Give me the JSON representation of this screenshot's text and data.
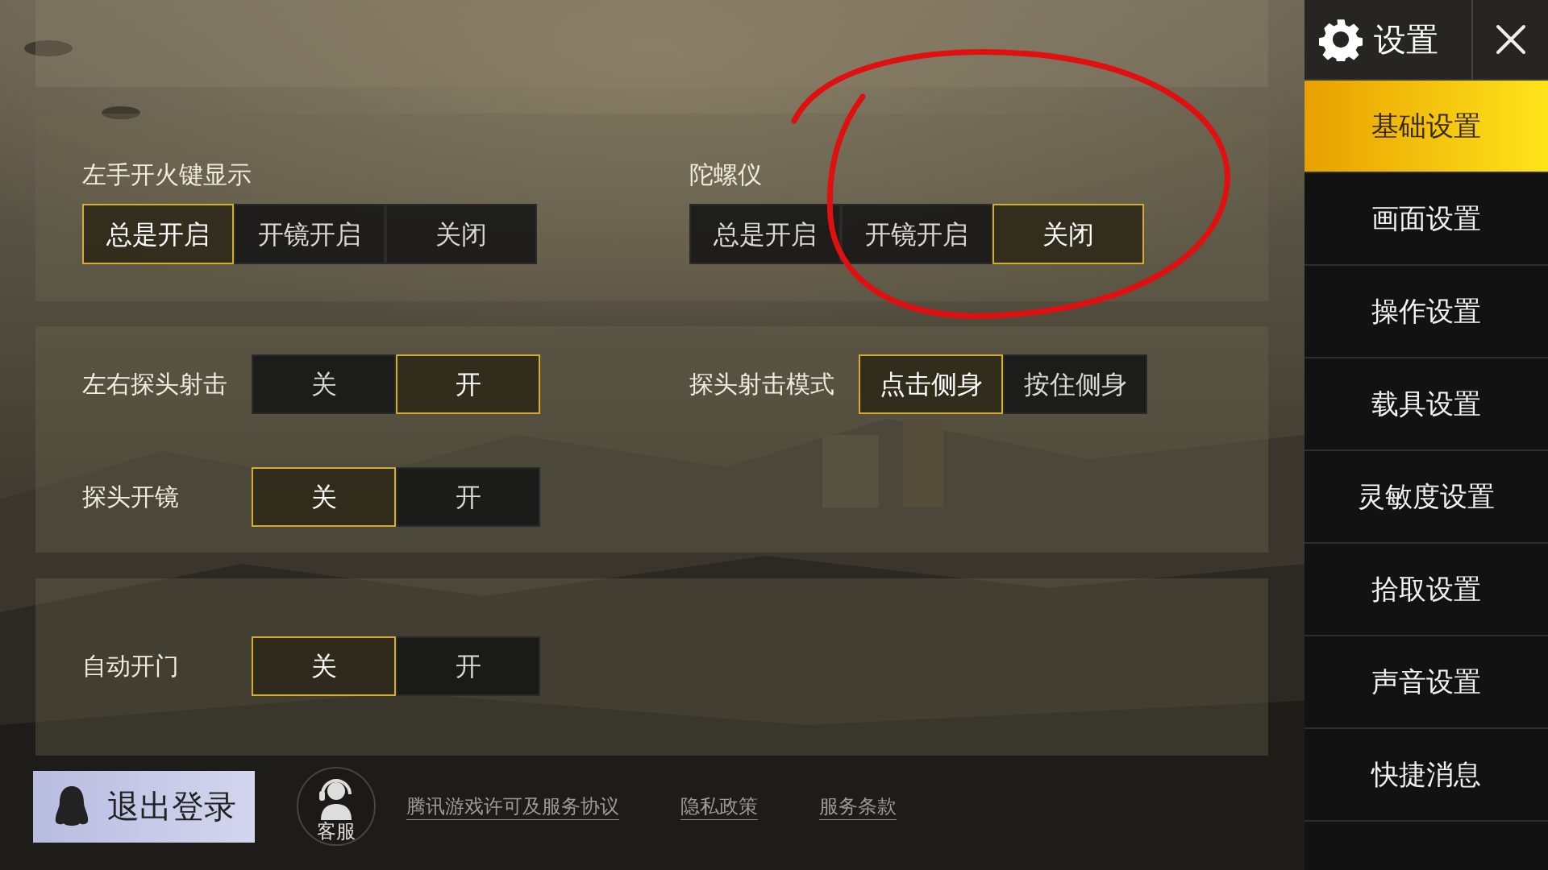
{
  "sidebar": {
    "title": "设置",
    "items": [
      {
        "label": "基础设置",
        "selected": true
      },
      {
        "label": "画面设置",
        "selected": false
      },
      {
        "label": "操作设置",
        "selected": false
      },
      {
        "label": "载具设置",
        "selected": false
      },
      {
        "label": "灵敏度设置",
        "selected": false
      },
      {
        "label": "拾取设置",
        "selected": false
      },
      {
        "label": "声音设置",
        "selected": false
      },
      {
        "label": "快捷消息",
        "selected": false
      }
    ]
  },
  "panels": [
    {
      "rows": [
        [
          {
            "kind": "stacked",
            "label": "左手开火键显示",
            "options": [
              {
                "label": "总是开启",
                "selected": true
              },
              {
                "label": "开镜开启",
                "selected": false
              },
              {
                "label": "关闭",
                "selected": false
              }
            ]
          },
          {
            "kind": "stacked",
            "label": "陀螺仪",
            "options": [
              {
                "label": "总是开启",
                "selected": false
              },
              {
                "label": "开镜开启",
                "selected": false
              },
              {
                "label": "关闭",
                "selected": true
              }
            ]
          }
        ]
      ]
    },
    {
      "rows": [
        [
          {
            "kind": "inline",
            "label": "左右探头射击",
            "options": [
              {
                "label": "关",
                "selected": false
              },
              {
                "label": "开",
                "selected": true
              }
            ]
          },
          {
            "kind": "inline",
            "label": "探头射击模式",
            "options": [
              {
                "label": "点击侧身",
                "selected": true
              },
              {
                "label": "按住侧身",
                "selected": false
              }
            ]
          }
        ],
        [
          {
            "kind": "inline",
            "label": "探头开镜",
            "options": [
              {
                "label": "关",
                "selected": true
              },
              {
                "label": "开",
                "selected": false
              }
            ]
          }
        ]
      ]
    },
    {
      "rows": [
        [
          {
            "kind": "inline",
            "label": "自动开门",
            "options": [
              {
                "label": "关",
                "selected": true
              },
              {
                "label": "开",
                "selected": false
              }
            ]
          }
        ]
      ]
    }
  ],
  "footer": {
    "logout": "退出登录",
    "support": "客服",
    "links": [
      "腾讯游戏许可及服务协议",
      "隐私政策",
      "服务条款"
    ]
  },
  "annotation": {
    "kind": "ellipse",
    "color": "#e01010"
  }
}
